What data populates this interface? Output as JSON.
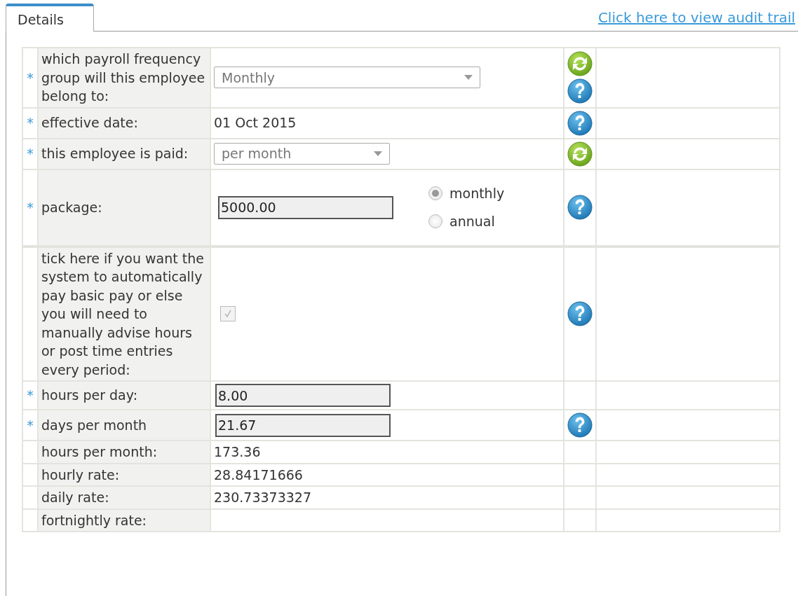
{
  "tab": {
    "label": "Details",
    "selected": true
  },
  "audit_link": "Click here to view audit trail",
  "rows": [
    {
      "kind": "select",
      "mark": "*",
      "label": "which payroll frequency group will this employee belong to:",
      "value": "Monthly",
      "icons": [
        {
          "kind": "refresh"
        },
        {
          "kind": "help"
        }
      ]
    },
    {
      "kind": "text",
      "mark": "*",
      "label": "effective date:",
      "value": "01 Oct 2015",
      "icons": [
        {
          "kind": "help"
        }
      ]
    },
    {
      "kind": "select",
      "mark": "*",
      "label": "this employee is paid:",
      "value": "per month",
      "icons": [
        {
          "kind": "refresh"
        }
      ]
    },
    {
      "kind": "package",
      "mark": "*",
      "label": "package:",
      "value": "5000.00",
      "options": [
        {
          "label": "monthly",
          "selected": true
        },
        {
          "label": "annual",
          "selected": false
        }
      ],
      "icons": [
        {
          "kind": "help"
        }
      ]
    },
    {
      "kind": "checkbox",
      "label": "tick here if you want the system to automatically pay basic pay or else you will need to manually advise hours or post time entries every period:",
      "checked": true,
      "icons": [
        {
          "kind": "help"
        }
      ]
    },
    {
      "kind": "input",
      "mark": "*",
      "label": "hours per day:",
      "value": "8.00"
    },
    {
      "kind": "input",
      "mark": "*",
      "label": "days per month",
      "value": "21.67",
      "icons": [
        {
          "kind": "help"
        }
      ]
    },
    {
      "kind": "text",
      "label": "hours per month:",
      "value": "173.36"
    },
    {
      "kind": "text",
      "label": "hourly rate:",
      "value": "28.84171666"
    },
    {
      "kind": "text",
      "label": "daily rate:",
      "value": "230.73373327"
    },
    {
      "kind": "text",
      "label": "fortnightly rate:"
    }
  ]
}
